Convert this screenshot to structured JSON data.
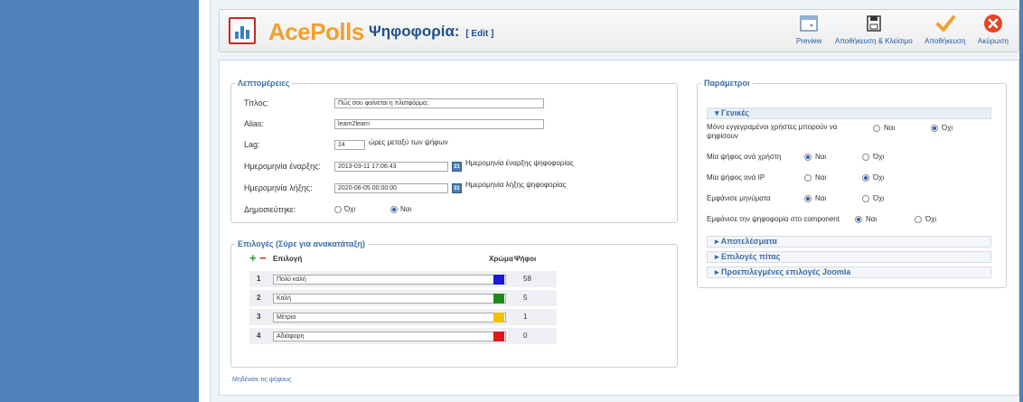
{
  "header": {
    "brand": "AcePolls",
    "title": "Ψηφοφορία:",
    "edit_tag": "[ Edit ]",
    "toolbar": [
      {
        "label": "Preview",
        "icon": "preview-icon"
      },
      {
        "label": "Αποθήκευση & Κλείσιμο",
        "icon": "save-close-icon"
      },
      {
        "label": "Αποθήκευση",
        "icon": "save-icon"
      },
      {
        "label": "Ακύρωση",
        "icon": "cancel-icon"
      }
    ]
  },
  "details": {
    "legend": "Λεπτομέρειες",
    "title_label": "Τίτλος:",
    "title_value": "Πώς σου φαίνεται η πλατφόρμα;",
    "alias_label": "Alias:",
    "alias_value": "learn2learn",
    "lag_label": "Lag:",
    "lag_value": "24",
    "lag_hint": "ώρες μεταξύ των ψήφων",
    "start_label": "Ημερομηνία έναρξης:",
    "start_value": "2013-03-11 17:06:43",
    "start_hint": "Ημερομηνία έναρξης ψηφοφορίας",
    "end_label": "Ημερομηνία λήξης:",
    "end_value": "2020-06-05 00:00:00",
    "end_hint": "Ημερομηνία λήξης ψηφοφορίας",
    "published_label": "Δημοσιεύτηκε:",
    "opt_no": "Όχι",
    "opt_yes": "Ναι"
  },
  "options": {
    "legend": "Επιλογές (Σύρε για ανακατάταξη)",
    "col_option": "Επιλογή",
    "col_color": "Χρώμα",
    "col_votes": "Ψήφοι",
    "rows": [
      {
        "num": "1",
        "text": "Πολύ καλή",
        "color": "#1a1ad8",
        "votes": "58"
      },
      {
        "num": "2",
        "text": "Καλή",
        "color": "#1e8a1e",
        "votes": "5"
      },
      {
        "num": "3",
        "text": "Μέτρια",
        "color": "#f2c200",
        "votes": "1"
      },
      {
        "num": "4",
        "text": "Αδιάφορη",
        "color": "#e01818",
        "votes": "0"
      }
    ],
    "reset_link": "Μηδένισε τις ψήφους"
  },
  "params": {
    "legend": "Παράμετροι",
    "general": "▾ Γενικές",
    "rows": [
      {
        "label": "Μόνο εγγεγραμένοι χρήστες μπορούν να ψηφίσουν",
        "yes": "Ναι",
        "no": "Όχι",
        "selected": "no"
      },
      {
        "label": "Μία ψήφος ανά χρήστη",
        "yes": "Ναι",
        "no": "Όχι",
        "selected": "yes"
      },
      {
        "label": "Μία ψήφος ανά IP",
        "yes": "Ναι",
        "no": "Όχι",
        "selected": "no"
      },
      {
        "label": "Εμφάνισε μηνύματα",
        "yes": "Ναι",
        "no": "Όχι",
        "selected": "yes"
      },
      {
        "label": "Εμφάνισε την ψηφοφορία στο component",
        "yes": "Ναι",
        "no": "Όχι",
        "selected": "yes"
      }
    ],
    "results": "▸ Αποτελέσματα",
    "pie": "▸ Επιλογές πίτας",
    "joomla": "▸ Προεπιλεγμένες επιλογές Joomla"
  }
}
